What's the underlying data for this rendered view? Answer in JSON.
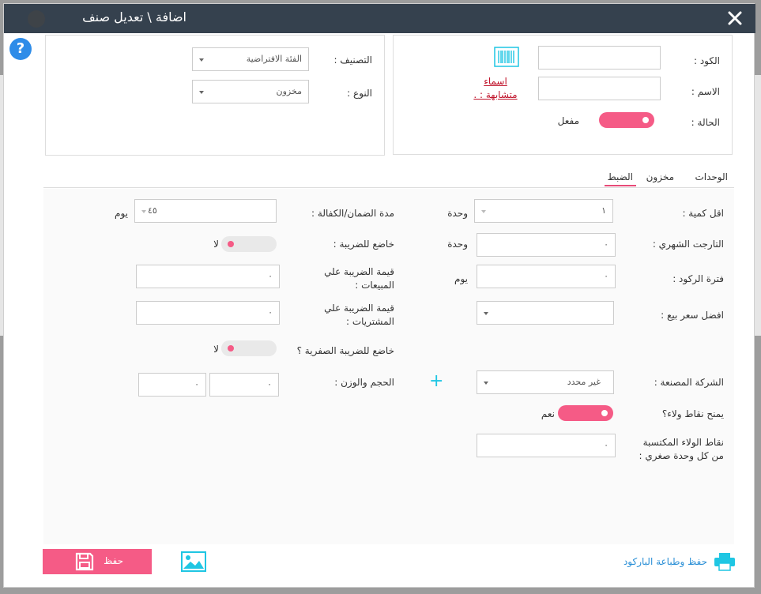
{
  "dialog": {
    "title": "اضافة \\ تعديل صنف"
  },
  "form_top": {
    "code_label": "الكود :",
    "code_value": "",
    "name_label": "الاسم :",
    "name_value": "",
    "similar_names_link_line1": "اسماء",
    "similar_names_link_line2": "متشابهة : .",
    "status_label": "الحالة :",
    "status_text": "مفعل",
    "category_label": "التصنيف :",
    "category_value": "الفئة الافتراضية",
    "type_label": "النوع :",
    "type_value": "مخزون"
  },
  "tabs": [
    {
      "label": "الوحدات",
      "active": false
    },
    {
      "label": "مخزون",
      "active": false
    },
    {
      "label": "الضبط",
      "active": true
    }
  ],
  "settings": {
    "min_qty_label": "اقل كمية :",
    "min_qty_value": "١",
    "min_qty_unit": "وحدة",
    "monthly_target_label": "التارجت الشهري :",
    "monthly_target_value": "٠",
    "monthly_target_unit": "وحدة",
    "stagnation_label": "فترة الركود :",
    "stagnation_value": "٠",
    "stagnation_unit": "يوم",
    "best_price_label": "افضل سعر بيع :",
    "best_price_value": "",
    "manufacturer_label": "الشركة المصنعة :",
    "manufacturer_value": "غير محدد",
    "loyalty_label": "يمنح نقاط ولاء؟",
    "loyalty_text": "نعم",
    "loyalty_points_label": "نقاط الولاء المكتسبة من كل وحدة صغري :",
    "loyalty_points_value": "٠",
    "warranty_label": "مدة الضمان/الكفالة :",
    "warranty_value": "٤٥",
    "warranty_unit": "يوم",
    "taxable_label": "خاضع للضريبة :",
    "taxable_text": "لا",
    "sales_tax_label": "قيمة الضريبة علي المبيعات :",
    "sales_tax_value": "٠",
    "purchase_tax_label": "قيمة الضريبة علي المشتريات :",
    "purchase_tax_value": "٠",
    "zero_tax_label": "خاضع للضريبة الصفرية ؟",
    "zero_tax_text": "لا",
    "size_weight_label": "الحجم والوزن :",
    "size_value": "٠",
    "weight_value": "٠"
  },
  "footer": {
    "save_label": "حفظ",
    "save_print_label": "حفظ وطباعة الباركود"
  },
  "colors": {
    "accent": "#f55b86",
    "titlebar": "#35414e",
    "link": "#2a8fd6",
    "help": "#2e8ce8"
  },
  "icons": [
    "close-icon",
    "help-icon",
    "barcode-icon",
    "caret-down-icon",
    "plus-icon",
    "save-icon",
    "image-icon",
    "printer-icon"
  ]
}
